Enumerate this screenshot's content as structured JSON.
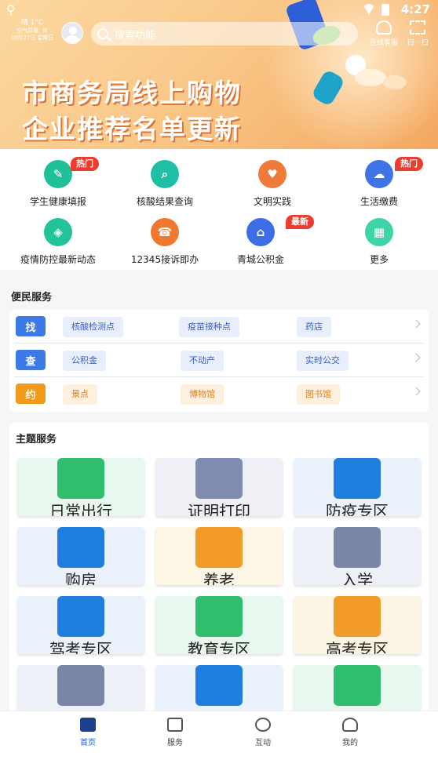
{
  "status": {
    "time": "4:27",
    "left_icon": "app-icon"
  },
  "weather": {
    "line1": "晴 1°C",
    "line2": "空气质量: 优",
    "line3": "10月27日 星期日"
  },
  "search": {
    "placeholder": "搜索功能"
  },
  "top_services": [
    {
      "label": "在线客服",
      "icon": "headset-icon"
    },
    {
      "label": "扫一扫",
      "icon": "scan-icon"
    }
  ],
  "banner": {
    "line1": "市商务局线上购物",
    "line2": "企业推荐名单更新"
  },
  "quick": [
    {
      "label": "学生健康填报",
      "color": "#1fbf9a",
      "glyph": "✎",
      "badge": "热门"
    },
    {
      "label": "核酸结果查询",
      "color": "#1fbfa6",
      "glyph": "⌕",
      "badge": ""
    },
    {
      "label": "文明实践",
      "color": "#f07a3a",
      "glyph": "♥",
      "badge": ""
    },
    {
      "label": "生活缴费",
      "color": "#3f74e8",
      "glyph": "☁",
      "badge": "热门"
    },
    {
      "label": "疫情防控最新动态",
      "color": "#22c39a",
      "glyph": "◈",
      "badge": ""
    },
    {
      "label": "12345接诉即办",
      "color": "#f0772e",
      "glyph": "☎",
      "badge": ""
    },
    {
      "label": "青城公积金",
      "color": "#3b6ee6",
      "glyph": "⌂",
      "badge": "最新"
    },
    {
      "label": "更多",
      "color": "#3fd4a8",
      "glyph": "▦",
      "badge": ""
    }
  ],
  "convenience": {
    "title": "便民服务",
    "rows": [
      {
        "tag": "找",
        "tag_color": "#3c7ae8",
        "chip_bg": "#e8eefc",
        "chip_color": "#3a5fc7",
        "items": [
          "核酸检测点",
          "疫苗接种点",
          "药店"
        ]
      },
      {
        "tag": "查",
        "tag_color": "#3c7ae8",
        "chip_bg": "#e8eefc",
        "chip_color": "#3a5fc7",
        "items": [
          "公积金",
          "不动产",
          "实时公交"
        ]
      },
      {
        "tag": "约",
        "tag_color": "#f39a1a",
        "chip_bg": "#fdf0de",
        "chip_color": "#d9822a",
        "items": [
          "景点",
          "博物馆",
          "图书馆"
        ]
      }
    ]
  },
  "theme": {
    "title": "主题服务",
    "cards": [
      {
        "label": "日常出行",
        "icon": "bus-icon",
        "bg": "#e8f8ef",
        "art": "#2fbf6e"
      },
      {
        "label": "证明打印",
        "icon": "printer-icon",
        "bg": "#eef0f6",
        "art": "#7f8bb0"
      },
      {
        "label": "防疫专区",
        "icon": "medical-kit-icon",
        "bg": "#eaf2fc",
        "art": "#1e7fe0"
      },
      {
        "label": "购房",
        "icon": "building-icon",
        "bg": "#eaf1fc",
        "art": "#1e7fe0"
      },
      {
        "label": "养老",
        "icon": "elderly-icon",
        "bg": "#fdf6e4",
        "art": "#f39b2a"
      },
      {
        "label": "入学",
        "icon": "student-icon",
        "bg": "#eef0f7",
        "art": "#7a86a8"
      },
      {
        "label": "驾考专区",
        "icon": "car-icon",
        "bg": "#eaf2fc",
        "art": "#1e7fe0"
      },
      {
        "label": "教育专区",
        "icon": "education-icon",
        "bg": "#e8f8ef",
        "art": "#2fbf6e"
      },
      {
        "label": "高考专区",
        "icon": "exam-icon",
        "bg": "#fdf5e3",
        "art": "#f39b2a"
      },
      {
        "label": "",
        "icon": "graduation-cap-icon",
        "bg": "#eef0f7",
        "art": "#7a86a8"
      },
      {
        "label": "",
        "icon": "recruit-icon",
        "bg": "#eaf2fc",
        "art": "#1e7fe0"
      },
      {
        "label": "",
        "icon": "family-icon",
        "bg": "#e8f8ef",
        "art": "#2fbf6e"
      }
    ]
  },
  "tabs": [
    {
      "label": "首页",
      "icon": "home-icon",
      "active": true
    },
    {
      "label": "服务",
      "icon": "service-icon",
      "active": false
    },
    {
      "label": "互动",
      "icon": "chat-icon",
      "active": false
    },
    {
      "label": "我的",
      "icon": "profile-icon",
      "active": false
    }
  ]
}
